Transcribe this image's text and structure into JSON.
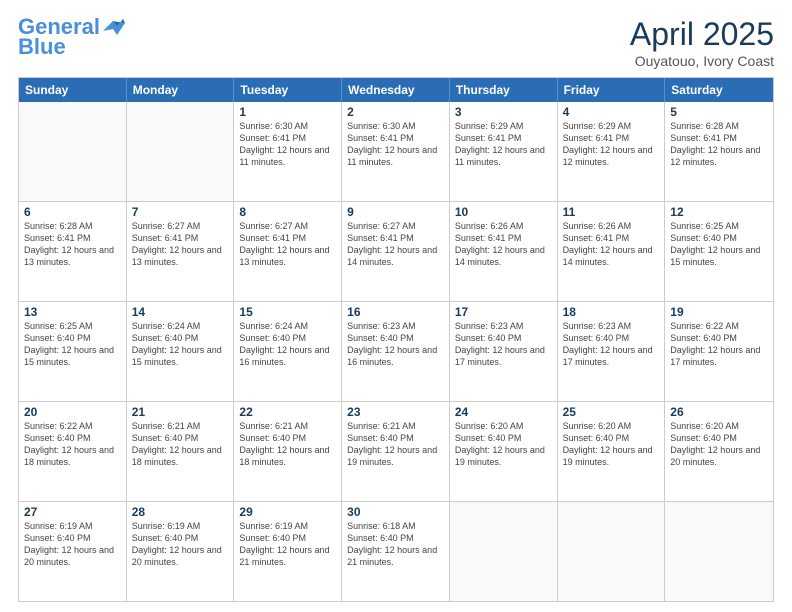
{
  "logo": {
    "line1": "General",
    "line2": "Blue"
  },
  "title": "April 2025",
  "subtitle": "Ouyatouo, Ivory Coast",
  "header_days": [
    "Sunday",
    "Monday",
    "Tuesday",
    "Wednesday",
    "Thursday",
    "Friday",
    "Saturday"
  ],
  "weeks": [
    [
      {
        "day": "",
        "info": ""
      },
      {
        "day": "",
        "info": ""
      },
      {
        "day": "1",
        "info": "Sunrise: 6:30 AM\nSunset: 6:41 PM\nDaylight: 12 hours and 11 minutes."
      },
      {
        "day": "2",
        "info": "Sunrise: 6:30 AM\nSunset: 6:41 PM\nDaylight: 12 hours and 11 minutes."
      },
      {
        "day": "3",
        "info": "Sunrise: 6:29 AM\nSunset: 6:41 PM\nDaylight: 12 hours and 11 minutes."
      },
      {
        "day": "4",
        "info": "Sunrise: 6:29 AM\nSunset: 6:41 PM\nDaylight: 12 hours and 12 minutes."
      },
      {
        "day": "5",
        "info": "Sunrise: 6:28 AM\nSunset: 6:41 PM\nDaylight: 12 hours and 12 minutes."
      }
    ],
    [
      {
        "day": "6",
        "info": "Sunrise: 6:28 AM\nSunset: 6:41 PM\nDaylight: 12 hours and 13 minutes."
      },
      {
        "day": "7",
        "info": "Sunrise: 6:27 AM\nSunset: 6:41 PM\nDaylight: 12 hours and 13 minutes."
      },
      {
        "day": "8",
        "info": "Sunrise: 6:27 AM\nSunset: 6:41 PM\nDaylight: 12 hours and 13 minutes."
      },
      {
        "day": "9",
        "info": "Sunrise: 6:27 AM\nSunset: 6:41 PM\nDaylight: 12 hours and 14 minutes."
      },
      {
        "day": "10",
        "info": "Sunrise: 6:26 AM\nSunset: 6:41 PM\nDaylight: 12 hours and 14 minutes."
      },
      {
        "day": "11",
        "info": "Sunrise: 6:26 AM\nSunset: 6:41 PM\nDaylight: 12 hours and 14 minutes."
      },
      {
        "day": "12",
        "info": "Sunrise: 6:25 AM\nSunset: 6:40 PM\nDaylight: 12 hours and 15 minutes."
      }
    ],
    [
      {
        "day": "13",
        "info": "Sunrise: 6:25 AM\nSunset: 6:40 PM\nDaylight: 12 hours and 15 minutes."
      },
      {
        "day": "14",
        "info": "Sunrise: 6:24 AM\nSunset: 6:40 PM\nDaylight: 12 hours and 15 minutes."
      },
      {
        "day": "15",
        "info": "Sunrise: 6:24 AM\nSunset: 6:40 PM\nDaylight: 12 hours and 16 minutes."
      },
      {
        "day": "16",
        "info": "Sunrise: 6:23 AM\nSunset: 6:40 PM\nDaylight: 12 hours and 16 minutes."
      },
      {
        "day": "17",
        "info": "Sunrise: 6:23 AM\nSunset: 6:40 PM\nDaylight: 12 hours and 17 minutes."
      },
      {
        "day": "18",
        "info": "Sunrise: 6:23 AM\nSunset: 6:40 PM\nDaylight: 12 hours and 17 minutes."
      },
      {
        "day": "19",
        "info": "Sunrise: 6:22 AM\nSunset: 6:40 PM\nDaylight: 12 hours and 17 minutes."
      }
    ],
    [
      {
        "day": "20",
        "info": "Sunrise: 6:22 AM\nSunset: 6:40 PM\nDaylight: 12 hours and 18 minutes."
      },
      {
        "day": "21",
        "info": "Sunrise: 6:21 AM\nSunset: 6:40 PM\nDaylight: 12 hours and 18 minutes."
      },
      {
        "day": "22",
        "info": "Sunrise: 6:21 AM\nSunset: 6:40 PM\nDaylight: 12 hours and 18 minutes."
      },
      {
        "day": "23",
        "info": "Sunrise: 6:21 AM\nSunset: 6:40 PM\nDaylight: 12 hours and 19 minutes."
      },
      {
        "day": "24",
        "info": "Sunrise: 6:20 AM\nSunset: 6:40 PM\nDaylight: 12 hours and 19 minutes."
      },
      {
        "day": "25",
        "info": "Sunrise: 6:20 AM\nSunset: 6:40 PM\nDaylight: 12 hours and 19 minutes."
      },
      {
        "day": "26",
        "info": "Sunrise: 6:20 AM\nSunset: 6:40 PM\nDaylight: 12 hours and 20 minutes."
      }
    ],
    [
      {
        "day": "27",
        "info": "Sunrise: 6:19 AM\nSunset: 6:40 PM\nDaylight: 12 hours and 20 minutes."
      },
      {
        "day": "28",
        "info": "Sunrise: 6:19 AM\nSunset: 6:40 PM\nDaylight: 12 hours and 20 minutes."
      },
      {
        "day": "29",
        "info": "Sunrise: 6:19 AM\nSunset: 6:40 PM\nDaylight: 12 hours and 21 minutes."
      },
      {
        "day": "30",
        "info": "Sunrise: 6:18 AM\nSunset: 6:40 PM\nDaylight: 12 hours and 21 minutes."
      },
      {
        "day": "",
        "info": ""
      },
      {
        "day": "",
        "info": ""
      },
      {
        "day": "",
        "info": ""
      }
    ]
  ]
}
